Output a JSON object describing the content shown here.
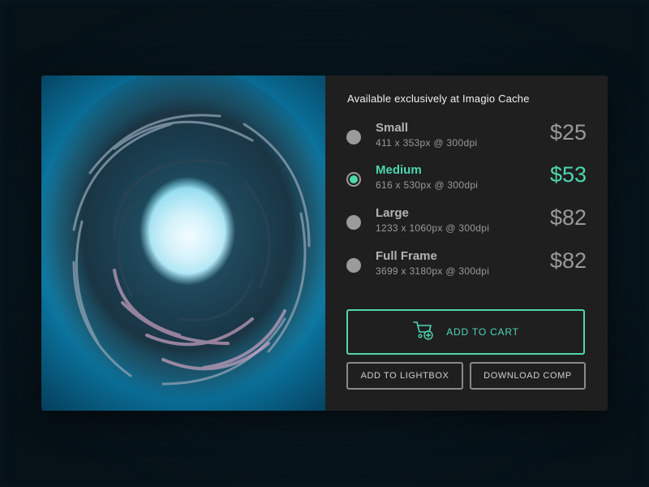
{
  "headline": "Available exclusively at Imagio Cache",
  "options": [
    {
      "name": "Small",
      "dims": "411 x 353px @ 300dpi",
      "price": "$25",
      "selected": false
    },
    {
      "name": "Medium",
      "dims": "616 x 530px @ 300dpi",
      "price": "$53",
      "selected": true
    },
    {
      "name": "Large",
      "dims": "1233 x 1060px @ 300dpi",
      "price": "$82",
      "selected": false
    },
    {
      "name": "Full Frame",
      "dims": "3699 x 3180px @ 300dpi",
      "price": "$82",
      "selected": false
    }
  ],
  "buttons": {
    "add_to_cart": "ADD TO CART",
    "add_to_lightbox": "ADD TO LIGHTBOX",
    "download_comp": "DOWNLOAD COMP"
  },
  "icons": {
    "cart": "cart-add-icon"
  },
  "colors": {
    "accent": "#4ed7ad",
    "panel": "#1f1f1f",
    "muted": "#9a9a9a"
  }
}
